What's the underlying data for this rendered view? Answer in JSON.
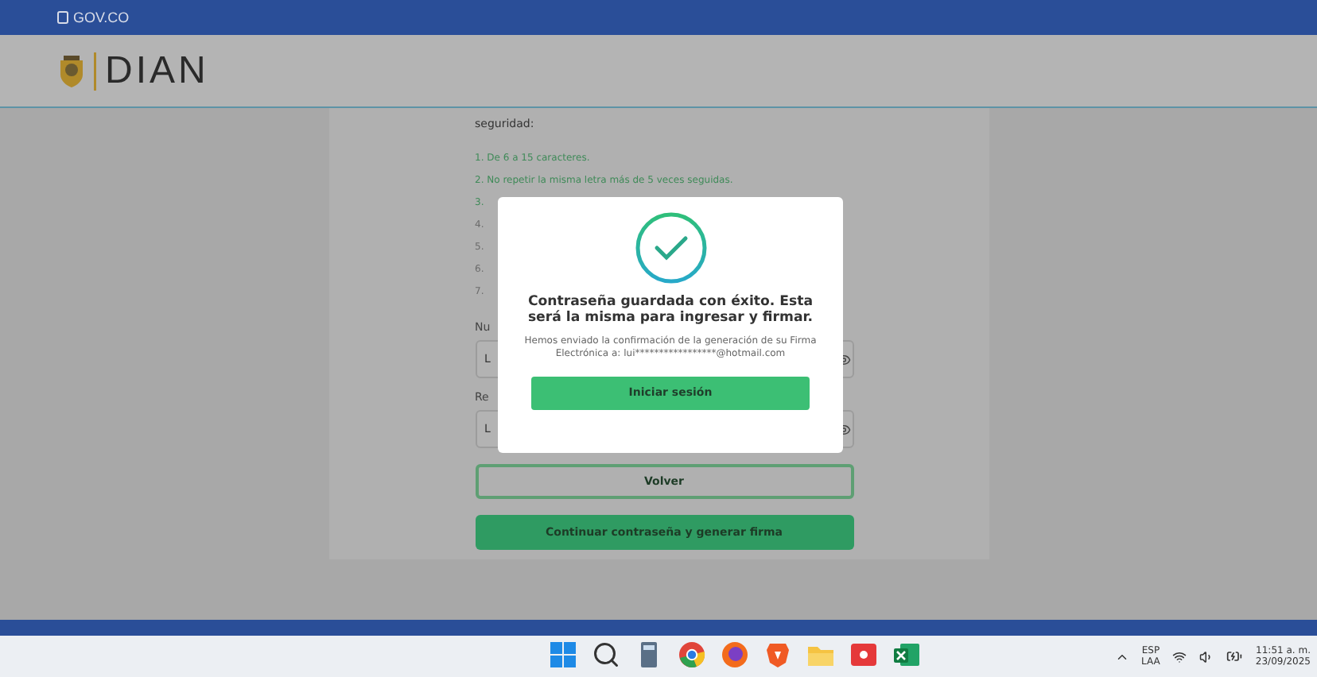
{
  "gov_bar": {
    "label": "GOV.CO"
  },
  "header": {
    "logo_text": "DIAN"
  },
  "form": {
    "intro": "seguridad:",
    "rules": [
      {
        "text": "1. De 6 a 15 caracteres.",
        "met": true
      },
      {
        "text": "2. No repetir la misma letra más de 5 veces seguidas.",
        "met": true
      },
      {
        "text": "3.",
        "met": true
      },
      {
        "text": "4.",
        "met": false
      },
      {
        "text": "5.",
        "met": false
      },
      {
        "text": "6.",
        "met": false
      },
      {
        "text": "7.",
        "met": false
      }
    ],
    "fields": [
      {
        "label": "Nu",
        "value": "L"
      },
      {
        "label": "Re",
        "value": "L"
      }
    ],
    "buttons": [
      {
        "label": "Volver",
        "kind": "outline"
      },
      {
        "label": "Continuar contraseña y generar firma",
        "kind": "solid"
      }
    ]
  },
  "modal": {
    "title": "Contraseña guardada con éxito. Esta será la misma para ingresar y firmar.",
    "message": "Hemos enviado la confirmación de la generación de su Firma Electrónica a: lui*****************@hotmail.com",
    "button": "Iniciar sesión"
  },
  "taskbar": {
    "apps": [
      {
        "kind": "start"
      },
      {
        "kind": "search"
      },
      {
        "kind": "calculator"
      },
      {
        "kind": "chrome"
      },
      {
        "kind": "firefox"
      },
      {
        "kind": "brave"
      },
      {
        "kind": "folder"
      },
      {
        "kind": "video"
      },
      {
        "kind": "excel"
      }
    ],
    "language": [
      "ESP",
      "LAA"
    ],
    "time": "11:51 a. m.",
    "date": "23/09/2025"
  }
}
